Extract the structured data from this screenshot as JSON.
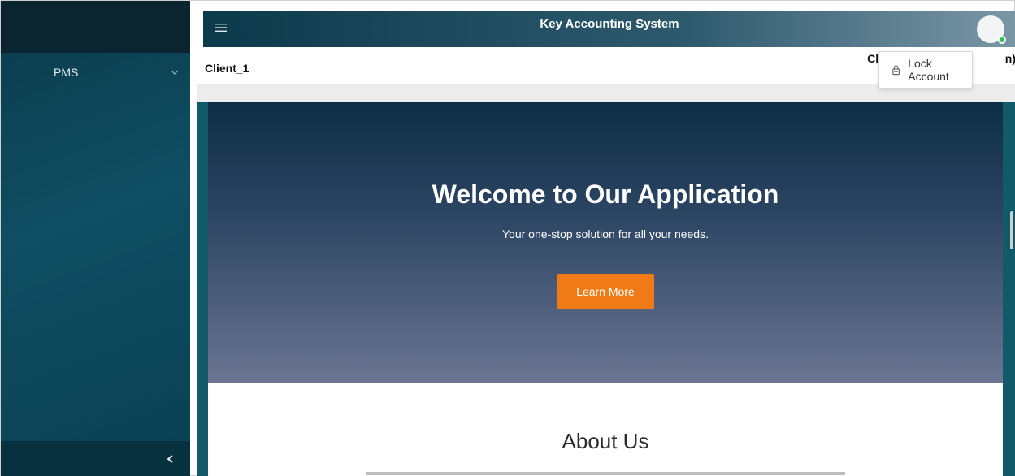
{
  "sidebar": {
    "menu_label": "PMS",
    "chevron_icon": "chevron-down-icon",
    "collapse_icon": "chevron-left-icon"
  },
  "topbar": {
    "menu_icon": "hamburger-icon",
    "title": "Key Accounting System",
    "avatar_status_color": "#27c34b"
  },
  "subheader": {
    "client": "Client_1",
    "right_text_left": "Client A",
    "right_text_right": "n)"
  },
  "dropdown": {
    "icon": "lock-icon",
    "item_label": "Lock Account"
  },
  "hero": {
    "title": "Welcome to Our Application",
    "subtitle": "Your one-stop solution for all your needs.",
    "button_label": "Learn More",
    "button_color": "#f07b16"
  },
  "about": {
    "heading": "About Us"
  }
}
